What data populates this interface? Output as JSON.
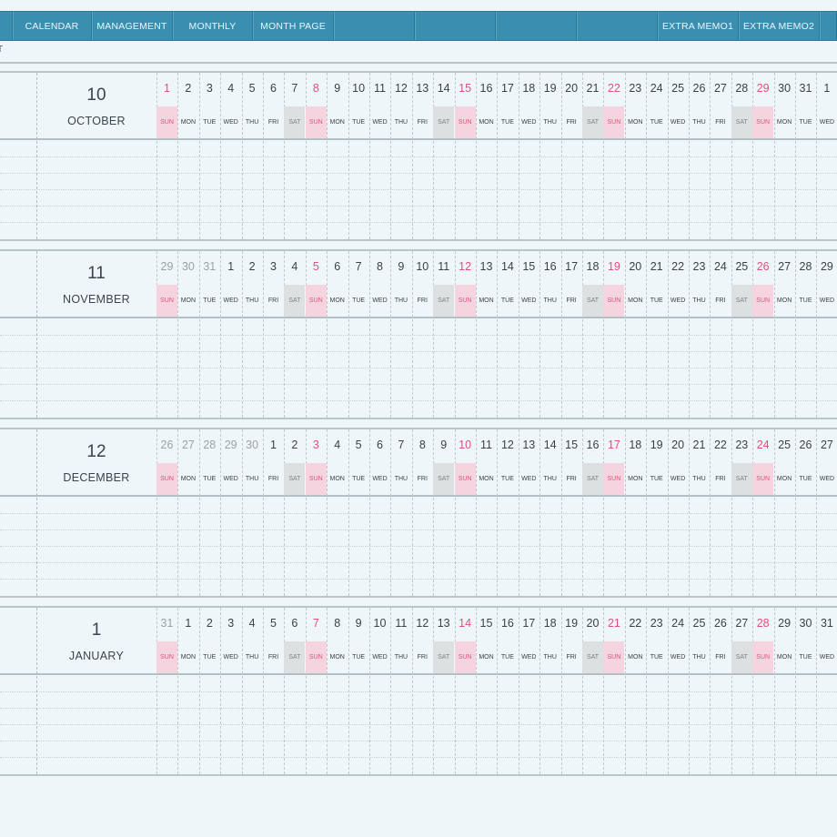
{
  "nav": {
    "tabs": [
      {
        "label": ""
      },
      {
        "label": "CALENDAR"
      },
      {
        "label": "MANAGEMENT"
      },
      {
        "label": "MONTHLY"
      },
      {
        "label": "MONTH PAGE"
      },
      {
        "label": ""
      },
      {
        "label": ""
      },
      {
        "label": ""
      },
      {
        "label": ""
      },
      {
        "label": "EXTRA MEMO1"
      },
      {
        "label": "EXTRA MEMO2"
      },
      {
        "label": ""
      }
    ]
  },
  "subheader": {
    "text": "T"
  },
  "weekday_labels": [
    "SUN",
    "MON",
    "TUE",
    "WED",
    "THU",
    "FRI",
    "SAT"
  ],
  "months": [
    {
      "number": "10",
      "name": "OCTOBER",
      "days": [
        "1",
        "2",
        "3",
        "4",
        "5",
        "6",
        "7",
        "8",
        "9",
        "10",
        "11",
        "12",
        "13",
        "14",
        "15",
        "16",
        "17",
        "18",
        "19",
        "20",
        "21",
        "22",
        "23",
        "24",
        "25",
        "26",
        "27",
        "28",
        "29",
        "30",
        "31",
        "1"
      ],
      "prev_count": 0
    },
    {
      "number": "11",
      "name": "NOVEMBER",
      "days": [
        "29",
        "30",
        "31",
        "1",
        "2",
        "3",
        "4",
        "5",
        "6",
        "7",
        "8",
        "9",
        "10",
        "11",
        "12",
        "13",
        "14",
        "15",
        "16",
        "17",
        "18",
        "19",
        "20",
        "21",
        "22",
        "23",
        "24",
        "25",
        "26",
        "27",
        "28",
        "29"
      ],
      "prev_count": 3
    },
    {
      "number": "12",
      "name": "DECEMBER",
      "days": [
        "26",
        "27",
        "28",
        "29",
        "30",
        "1",
        "2",
        "3",
        "4",
        "5",
        "6",
        "7",
        "8",
        "9",
        "10",
        "11",
        "12",
        "13",
        "14",
        "15",
        "16",
        "17",
        "18",
        "19",
        "20",
        "21",
        "22",
        "23",
        "24",
        "25",
        "26",
        "27"
      ],
      "prev_count": 5
    },
    {
      "number": "1",
      "name": "JANUARY",
      "days": [
        "31",
        "1",
        "2",
        "3",
        "4",
        "5",
        "6",
        "7",
        "8",
        "9",
        "10",
        "11",
        "12",
        "13",
        "14",
        "15",
        "16",
        "17",
        "18",
        "19",
        "20",
        "21",
        "22",
        "23",
        "24",
        "25",
        "26",
        "27",
        "28",
        "29",
        "30",
        "31"
      ],
      "prev_count": 1
    }
  ],
  "colors": {
    "accent": "#3a8fb0",
    "sunday": "#e0517a",
    "sunday_bg": "#f5d4df",
    "saturday_bg": "#dde0e1",
    "background": "#eef6f9"
  }
}
